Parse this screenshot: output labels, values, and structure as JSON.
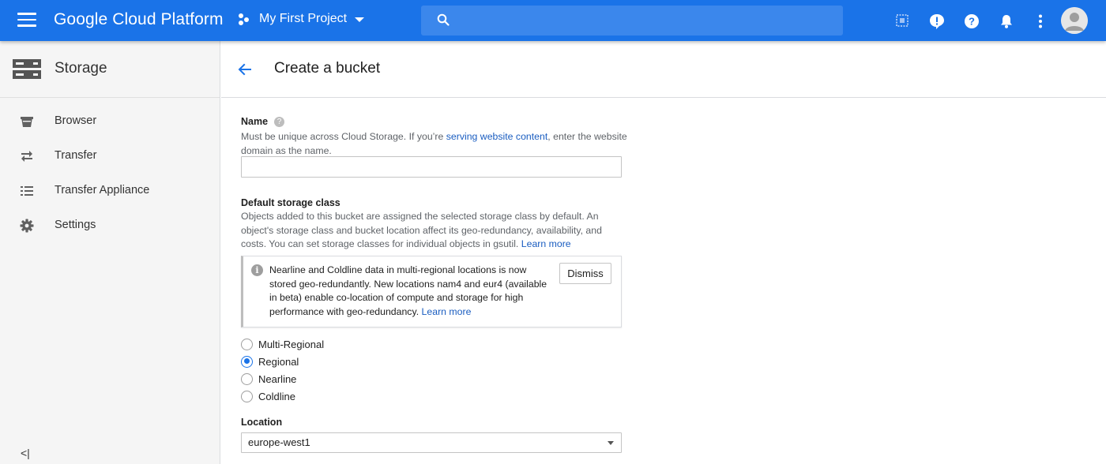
{
  "header": {
    "brand": "Google Cloud Platform",
    "project_name": "My First Project",
    "search_placeholder": ""
  },
  "sidebar": {
    "product_title": "Storage",
    "items": [
      {
        "label": "Browser",
        "icon": "bucket-icon"
      },
      {
        "label": "Transfer",
        "icon": "transfer-arrows-icon"
      },
      {
        "label": "Transfer Appliance",
        "icon": "list-icon"
      },
      {
        "label": "Settings",
        "icon": "gear-icon"
      }
    ],
    "collapse_label": "<|"
  },
  "main": {
    "title": "Create a bucket",
    "name_section": {
      "label": "Name",
      "help_before": "Must be unique across Cloud Storage. If you’re ",
      "help_link": "serving website content",
      "help_after": ", enter the website domain as the name.",
      "value": ""
    },
    "storage_class": {
      "label": "Default storage class",
      "help": "Objects added to this bucket are assigned the selected storage class by default. An object's storage class and bucket location affect its geo-redundancy, availability, and costs. You can set storage classes for individual objects in gsutil.",
      "help_link": "Learn more",
      "notice_text": "Nearline and Coldline data in multi-regional locations is now stored geo-redundantly. New locations nam4 and eur4 (available in beta) enable co-location of compute and storage for high performance with geo-redundancy.",
      "notice_link": "Learn more",
      "dismiss_label": "Dismiss",
      "options": [
        "Multi-Regional",
        "Regional",
        "Nearline",
        "Coldline"
      ],
      "selected": "Regional"
    },
    "location": {
      "label": "Location",
      "value": "europe-west1"
    }
  },
  "colors": {
    "topbar": "#1a73e8",
    "sidebar_bg": "#f5f5f5",
    "link": "#1a5dc0",
    "radio_selected": "#1a73e8"
  }
}
